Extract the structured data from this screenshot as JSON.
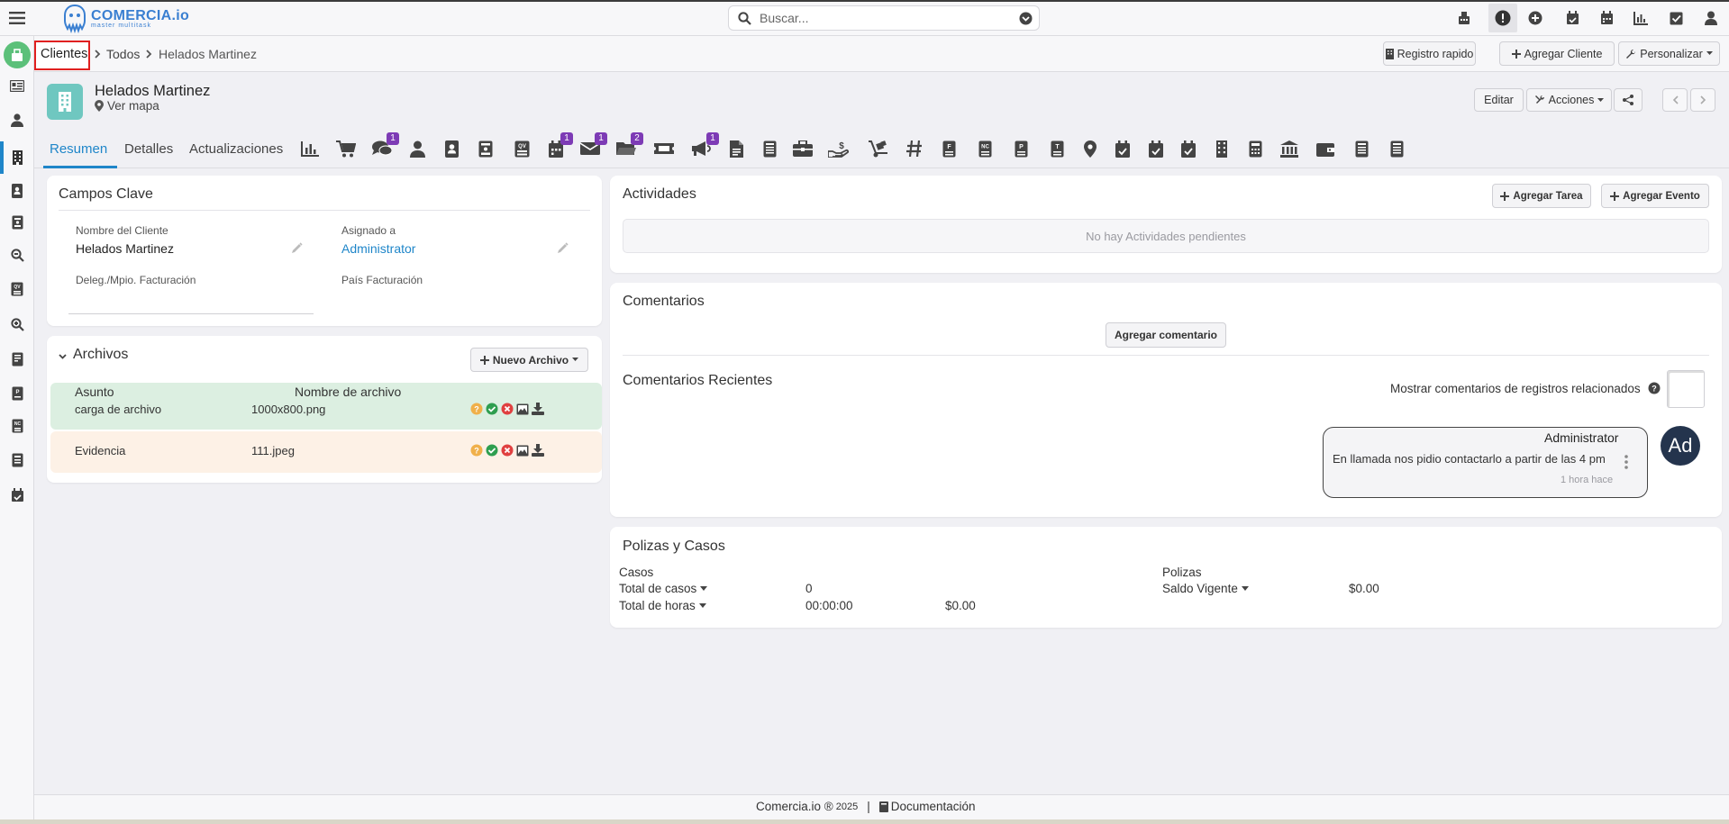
{
  "app": {
    "brand": "COMERCIA.io",
    "tagline": "master multitask"
  },
  "search": {
    "placeholder": "Buscar..."
  },
  "breadcrumb": {
    "root": "Clientes",
    "level1": "Todos",
    "current": "Helados Martinez"
  },
  "header_buttons": {
    "quick": "Registro rapido",
    "add": "Agregar Cliente",
    "custom": "Personalizar"
  },
  "record": {
    "name": "Helados Martinez",
    "map_link": "Ver mapa",
    "edit": "Editar",
    "actions": "Acciones"
  },
  "tabs": [
    {
      "label": "Resumen"
    },
    {
      "label": "Detalles"
    },
    {
      "label": "Actualizaciones"
    }
  ],
  "tab_badges": {
    "comments": "1",
    "calendar": "1",
    "email": "1",
    "files": "2",
    "campaigns": "1"
  },
  "key_fields": {
    "title": "Campos Clave",
    "client_name_label": "Nombre del Cliente",
    "client_name": "Helados Martinez",
    "assigned_label": "Asignado a",
    "assigned": "Administrator",
    "deleg_label": "Deleg./Mpio. Facturación",
    "deleg": "",
    "country_label": "País Facturación",
    "country": ""
  },
  "files": {
    "title": "Archivos",
    "new_button": "Nuevo Archivo",
    "col_subject": "Asunto",
    "col_filename": "Nombre de archivo",
    "rows": [
      {
        "subject": "carga de archivo",
        "filename": "1000x800.png"
      },
      {
        "subject": "Evidencia",
        "filename": "111.jpeg"
      }
    ]
  },
  "activities": {
    "title": "Actividades",
    "add_task": "Agregar Tarea",
    "add_event": "Agregar Evento",
    "empty": "No hay Actividades pendientes"
  },
  "comments": {
    "title": "Comentarios",
    "add": "Agregar comentario",
    "recent_title": "Comentarios Recientes",
    "show_related": "Mostrar comentarios de registros relacionados",
    "item": {
      "author": "Administrator",
      "text": "En llamada nos pidio contactarlo a partir de las 4 pm",
      "time": "1 hora hace",
      "avatar": "Ad"
    }
  },
  "policies": {
    "title": "Polizas y Casos",
    "cases_label": "Casos",
    "total_cases_label": "Total de casos",
    "total_cases": "0",
    "total_hours_label": "Total de horas",
    "total_hours": "00:00:00",
    "hours_amount": "$0.00",
    "policies_label": "Polizas",
    "balance_label": "Saldo Vigente",
    "balance": "$0.00"
  },
  "footer": {
    "copyright": "Comercia.io ®",
    "year": "2025",
    "separator": "|",
    "docs": "Documentación"
  },
  "colors": {
    "accent": "#1f86c9",
    "badge": "#7d3bb5",
    "teal": "#6fc7c0",
    "highlight": "#e02020"
  }
}
